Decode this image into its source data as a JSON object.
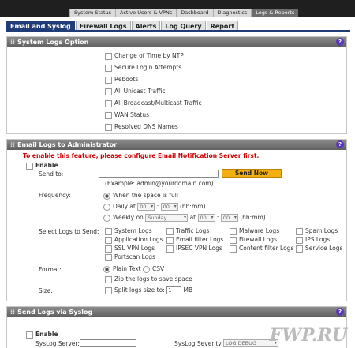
{
  "top_nav": [
    "System Status",
    "Active Users & VPNs",
    "Dashboard",
    "Diagnostics",
    "Logs & Reports"
  ],
  "tabs": [
    "Email and Syslog",
    "Firewall Logs",
    "Alerts",
    "Log Query",
    "Report"
  ],
  "system_logs": {
    "title": "System Logs Option",
    "options": [
      "Change of Time by NTP",
      "Secure Login Attempts",
      "Reboots",
      "All Unicast Traffic",
      "All Broadcast/Multicast Traffic",
      "WAN Status",
      "Resolved DNS Names"
    ]
  },
  "email_logs": {
    "title": "Email Logs to Administrator",
    "warning_prefix": "To enable this feature, please configure Email ",
    "warning_link": "Notification Server",
    "warning_suffix": " first.",
    "enable_label": "Enable",
    "send_to_label": "Send to:",
    "send_now_label": "Send Now",
    "example": "(Example: admin@yourdomain.com)",
    "frequency_label": "Frequency:",
    "freq_full": "When the space is full",
    "freq_daily": "Daily at",
    "freq_weekly": "Weekly on",
    "hh": "00",
    "mm": "00",
    "hhmm": "(hh:mm)",
    "colon": ":",
    "at": "at",
    "weekday": "Sunday",
    "select_logs_label": "Select Logs to Send:",
    "logs": [
      "System Logs",
      "Traffic Logs",
      "Malware Logs",
      "Spam Logs",
      "Application Logs",
      "Email filter Logs",
      "Firewall Logs",
      "IPS Logs",
      "SSL VPN Logs",
      "IPSEC VPN Logs",
      "Content filter Logs",
      "Service Logs",
      "Portscan Logs"
    ],
    "format_label": "Format:",
    "fmt_plain": "Plain Text",
    "fmt_csv": "CSV",
    "zip_label": "Zip the logs to save space",
    "size_label": "Size:",
    "split_label": "Split logs size to:",
    "split_value": "1",
    "split_unit": "MB"
  },
  "syslog": {
    "title": "Send Logs via Syslog",
    "enable_label": "Enable",
    "server_label": "SysLog Server:",
    "severity_label": "SysLog Severity:",
    "severity_value": "LOG DEBUG"
  },
  "watermark": "FWP.RU"
}
